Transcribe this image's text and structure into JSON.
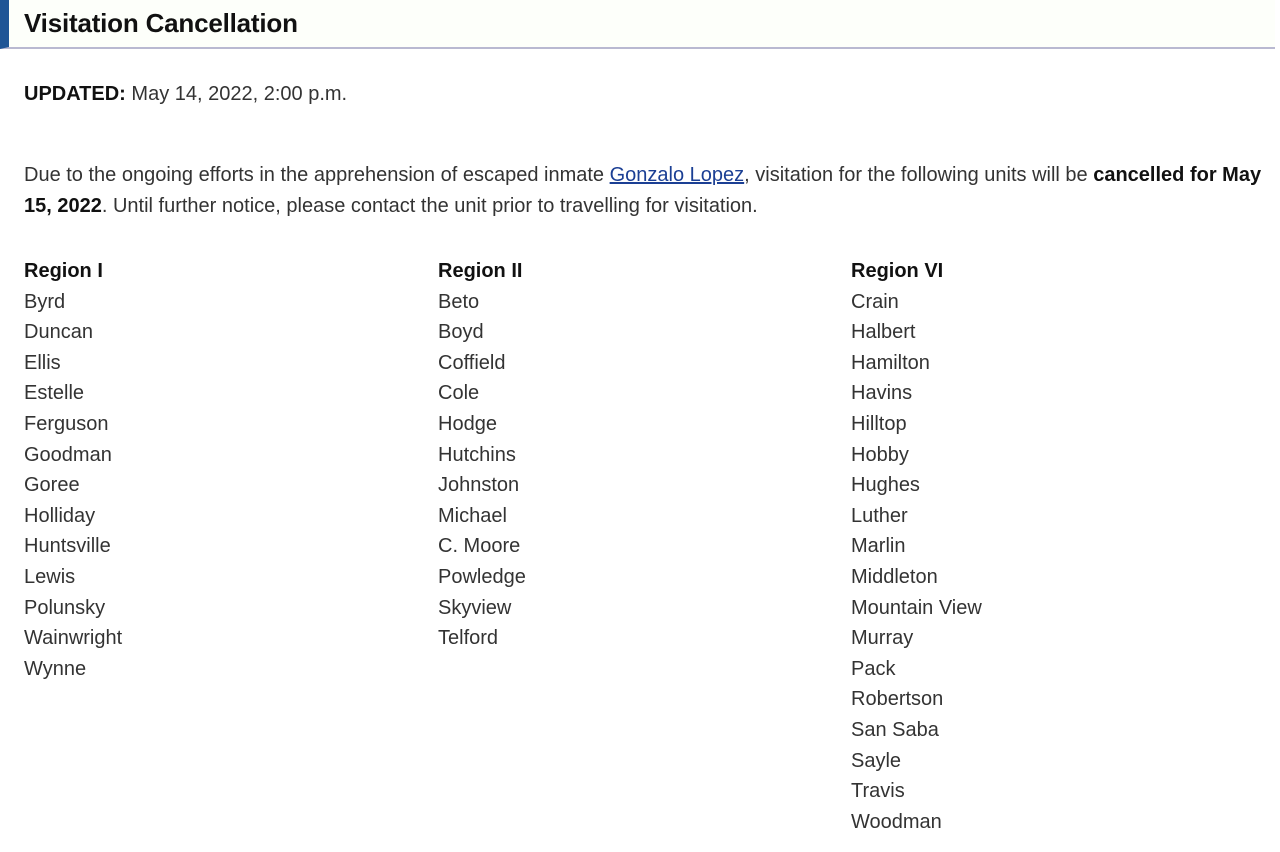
{
  "header": {
    "title": "Visitation Cancellation",
    "accent_bar_color": "#1f5596",
    "border_bottom_color": "#b9b9d1",
    "background_color": "#fdfffa"
  },
  "updated": {
    "label": "UPDATED:",
    "value": "May 14, 2022, 2:00 p.m."
  },
  "notice": {
    "text_before_link": "Due to the ongoing efforts in the apprehension of escaped inmate ",
    "link_text": "Gonzalo Lopez",
    "link_color": "#1b3f94",
    "text_after_link": ", visitation for the following units will be ",
    "bold_text": "cancelled for May 15, 2022",
    "text_end": ". Until further notice, please contact the unit prior to travelling for visitation."
  },
  "regions": [
    {
      "title": "Region I",
      "units": [
        "Byrd",
        "Duncan",
        "Ellis",
        "Estelle",
        "Ferguson",
        "Goodman",
        "Goree",
        "Holliday",
        "Huntsville",
        "Lewis",
        "Polunsky",
        "Wainwright",
        "Wynne"
      ]
    },
    {
      "title": "Region II",
      "units": [
        "Beto",
        "Boyd",
        "Coffield",
        "Cole",
        "Hodge",
        "Hutchins",
        "Johnston",
        "Michael",
        "C. Moore",
        "Powledge",
        "Skyview",
        "Telford"
      ]
    },
    {
      "title": "Region VI",
      "units": [
        "Crain",
        "Halbert",
        "Hamilton",
        "Havins",
        "Hilltop",
        "Hobby",
        "Hughes",
        "Luther",
        "Marlin",
        "Middleton",
        "Mountain View",
        "Murray",
        "Pack",
        "Robertson",
        "San Saba",
        "Sayle",
        "Travis",
        "Woodman"
      ]
    }
  ]
}
